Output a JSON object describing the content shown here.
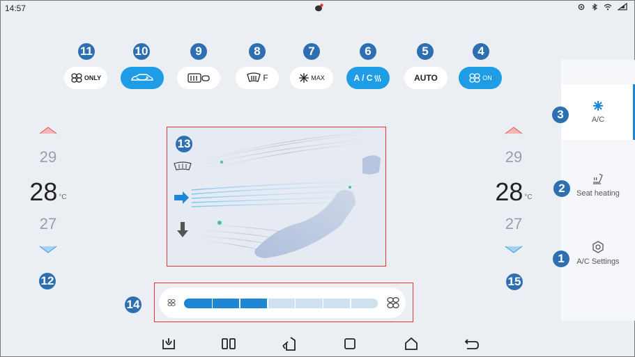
{
  "status": {
    "time": "14:57"
  },
  "controls": [
    {
      "id": "fan_only",
      "label": "ONLY",
      "icon": "fan-icon",
      "active": false
    },
    {
      "id": "recirculation",
      "label": "",
      "icon": "car-recirculation-icon",
      "active": true
    },
    {
      "id": "rear_defrost",
      "label": "",
      "icon": "rear-defrost-icon",
      "active": false
    },
    {
      "id": "front_defrost",
      "label": "F",
      "icon": "front-defrost-icon",
      "active": false
    },
    {
      "id": "max_ac",
      "label": "MAX",
      "icon": "snowflake-icon",
      "active": false
    },
    {
      "id": "ac",
      "label": "A / C",
      "icon": "ac-heat-icon",
      "active": true
    },
    {
      "id": "auto",
      "label": "AUTO",
      "icon": "",
      "active": false
    },
    {
      "id": "fan_on",
      "label": "ON",
      "icon": "fan-icon",
      "active": true
    }
  ],
  "callouts": [
    "1",
    "2",
    "3",
    "4",
    "5",
    "6",
    "7",
    "8",
    "9",
    "10",
    "11",
    "12",
    "13",
    "14",
    "15"
  ],
  "left_temp": {
    "upper": "29",
    "current": "28",
    "lower": "27",
    "unit": "°C"
  },
  "right_temp": {
    "upper": "29",
    "current": "28",
    "lower": "27",
    "unit": "°C"
  },
  "fan_speed": {
    "level": 3,
    "max": 7
  },
  "sidebar": {
    "items": [
      {
        "label": "A/C",
        "icon": "snowflake-icon",
        "active": true
      },
      {
        "label": "Seat heating",
        "icon": "seat-heat-icon",
        "active": false
      },
      {
        "label": "A/C Settings",
        "icon": "settings-hex-icon",
        "active": false
      }
    ]
  },
  "colors": {
    "accent": "#1f9ce6",
    "badge": "#2d6fb0",
    "highlight": "#e03434"
  }
}
